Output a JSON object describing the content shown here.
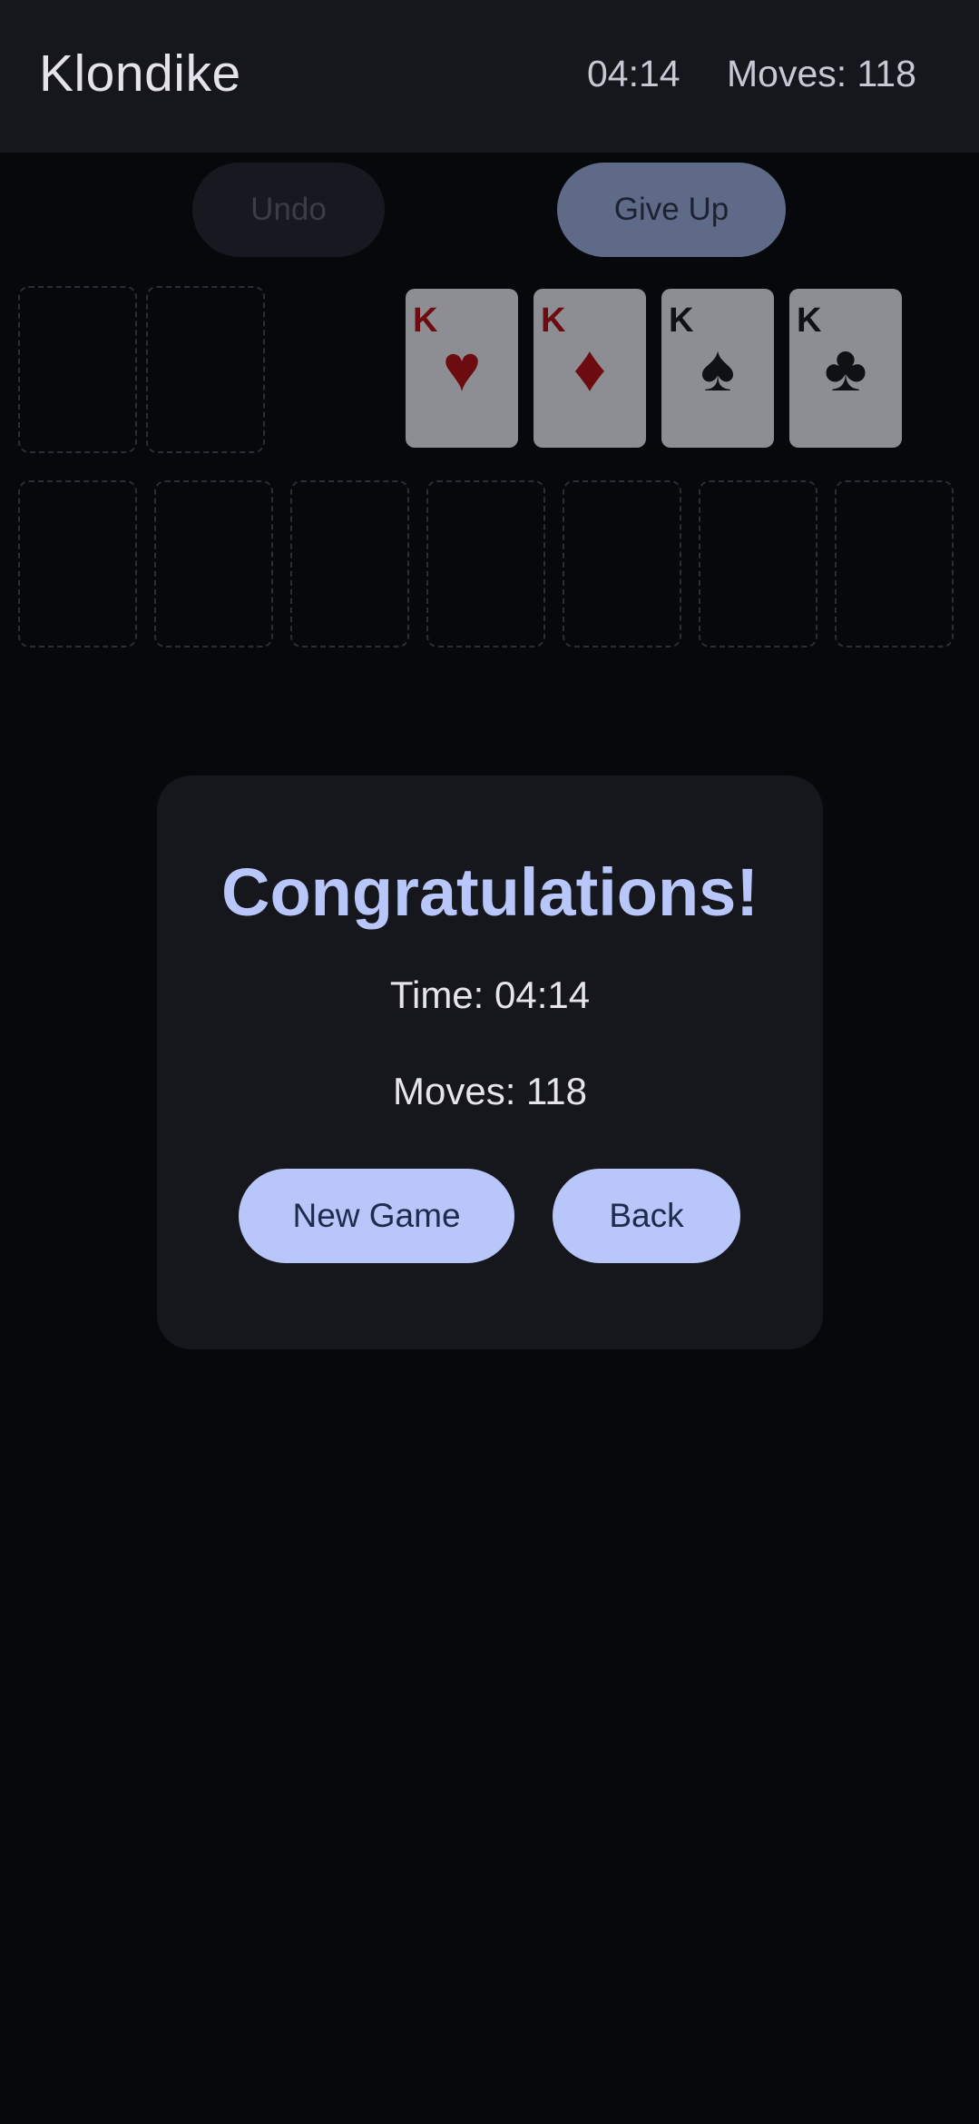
{
  "header": {
    "title": "Klondike",
    "timer": "04:14",
    "moves": "Moves: 118"
  },
  "controls": {
    "undo_label": "Undo",
    "give_up_label": "Give Up"
  },
  "foundations": [
    {
      "rank": "K",
      "suit": "♥",
      "suit_name": "hearts",
      "color": "red"
    },
    {
      "rank": "K",
      "suit": "♦",
      "suit_name": "diamonds",
      "color": "red"
    },
    {
      "rank": "K",
      "suit": "♠",
      "suit_name": "spades",
      "color": "black"
    },
    {
      "rank": "K",
      "suit": "♣",
      "suit_name": "clubs",
      "color": "black"
    }
  ],
  "dialog": {
    "title": "Congratulations!",
    "time": "Time: 04:14",
    "moves": "Moves: 118",
    "new_game_label": "New Game",
    "back_label": "Back"
  },
  "colors": {
    "accent": "#b8c6f9",
    "surface": "#16171d",
    "background": "#07080c"
  }
}
